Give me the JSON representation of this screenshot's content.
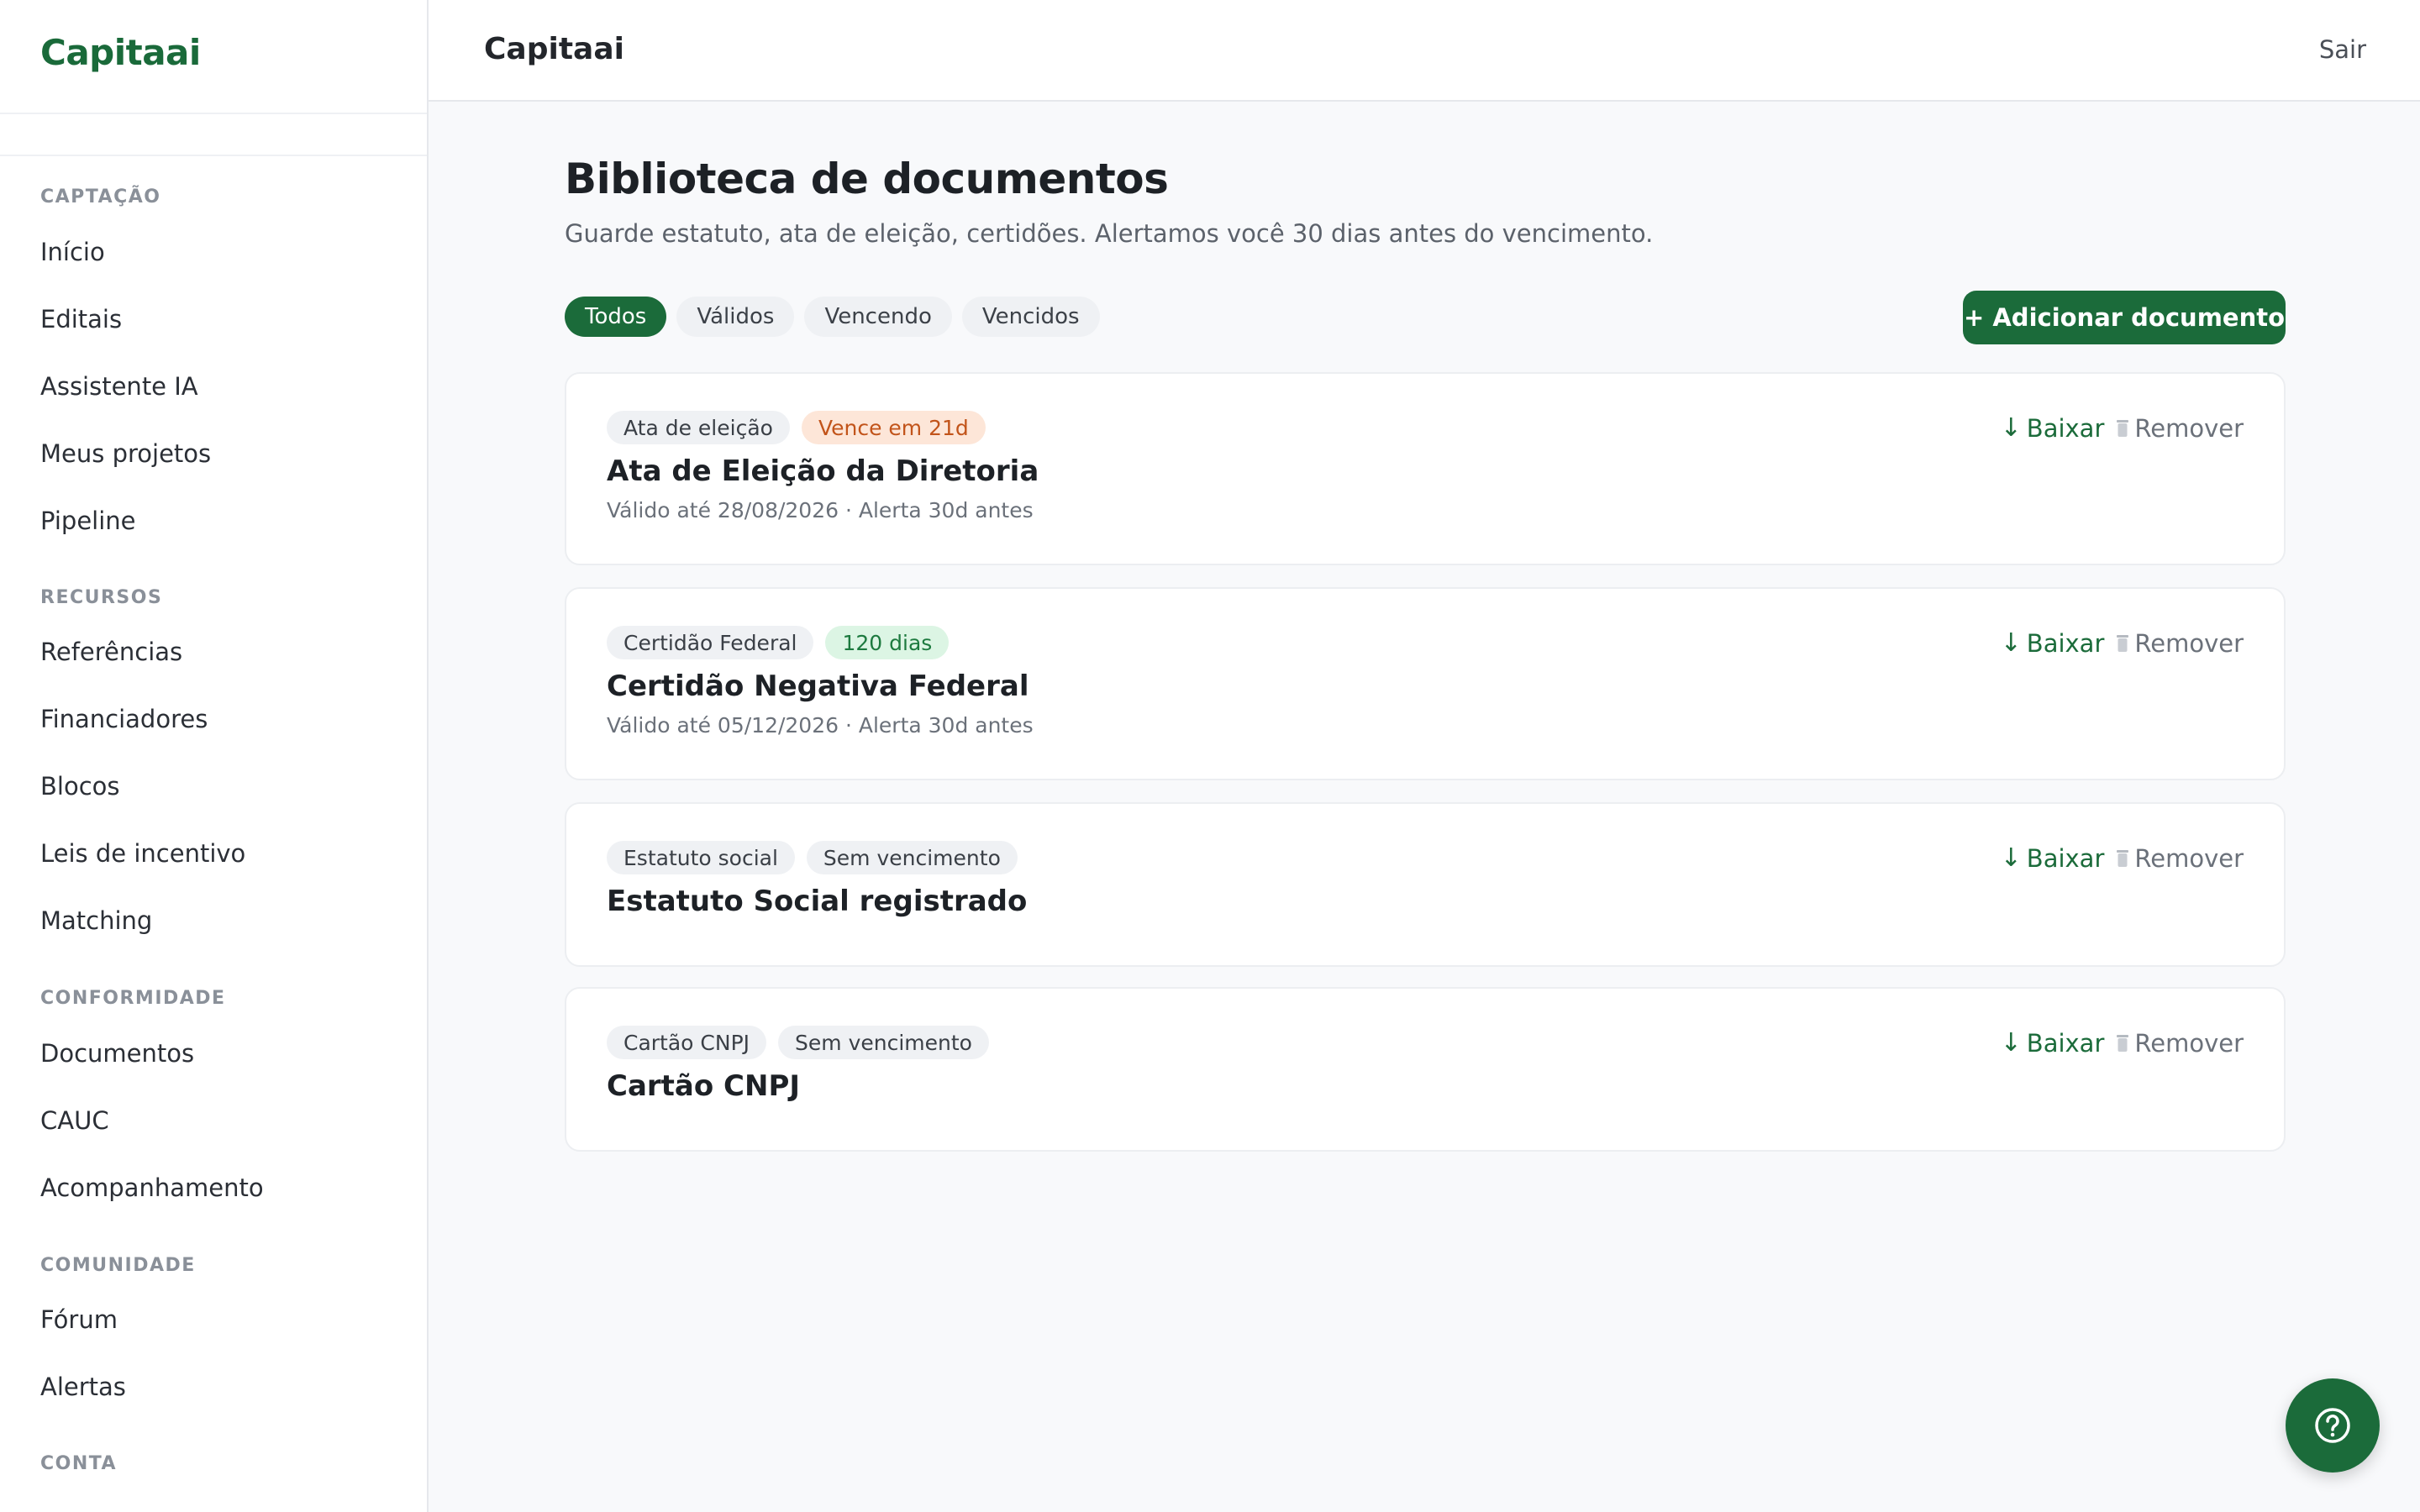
{
  "brand": "Capitaai",
  "header": {
    "title": "Capitaai",
    "logout": "Sair"
  },
  "sidebar": {
    "sections": [
      {
        "label": "CAPTAÇÃO",
        "items": [
          "Início",
          "Editais",
          "Assistente IA",
          "Meus projetos",
          "Pipeline"
        ]
      },
      {
        "label": "RECURSOS",
        "items": [
          "Referências",
          "Financiadores",
          "Blocos",
          "Leis de incentivo",
          "Matching"
        ]
      },
      {
        "label": "CONFORMIDADE",
        "items": [
          "Documentos",
          "CAUC",
          "Acompanhamento"
        ]
      },
      {
        "label": "COMUNIDADE",
        "items": [
          "Fórum",
          "Alertas"
        ]
      },
      {
        "label": "CONTA",
        "items": []
      }
    ]
  },
  "main": {
    "title": "Biblioteca de documentos",
    "subtitle": "Guarde estatuto, ata de eleição, certidões. Alertamos você 30 dias antes do vencimento.",
    "filters": [
      "Todos",
      "Válidos",
      "Vencendo",
      "Vencidos"
    ],
    "active_filter": "Todos",
    "add_button": "+ Adicionar documento",
    "actions": {
      "download": "Baixar",
      "remove": "Remover"
    },
    "documents": [
      {
        "type": "Ata de eleição",
        "status": "Vence em 21d",
        "status_kind": "warn",
        "title": "Ata de Eleição da Diretoria",
        "meta": "Válido até 28/08/2026 · Alerta 30d antes"
      },
      {
        "type": "Certidão Federal",
        "status": "120 dias",
        "status_kind": "ok",
        "title": "Certidão Negativa Federal",
        "meta": "Válido até 05/12/2026 · Alerta 30d antes"
      },
      {
        "type": "Estatuto social",
        "status": "Sem vencimento",
        "status_kind": "neutral",
        "title": "Estatuto Social registrado",
        "meta": ""
      },
      {
        "type": "Cartão CNPJ",
        "status": "Sem vencimento",
        "status_kind": "neutral",
        "title": "Cartão CNPJ",
        "meta": ""
      }
    ]
  },
  "icons": {
    "download": "arrow-down-icon",
    "remove": "trash-icon",
    "help": "question-circle-icon"
  },
  "colors": {
    "brand": "#1b6b3a",
    "warn_bg": "#fde6d8",
    "warn_text": "#c2541a",
    "ok_bg": "#dcf5e4",
    "ok_text": "#1d7a3f"
  }
}
